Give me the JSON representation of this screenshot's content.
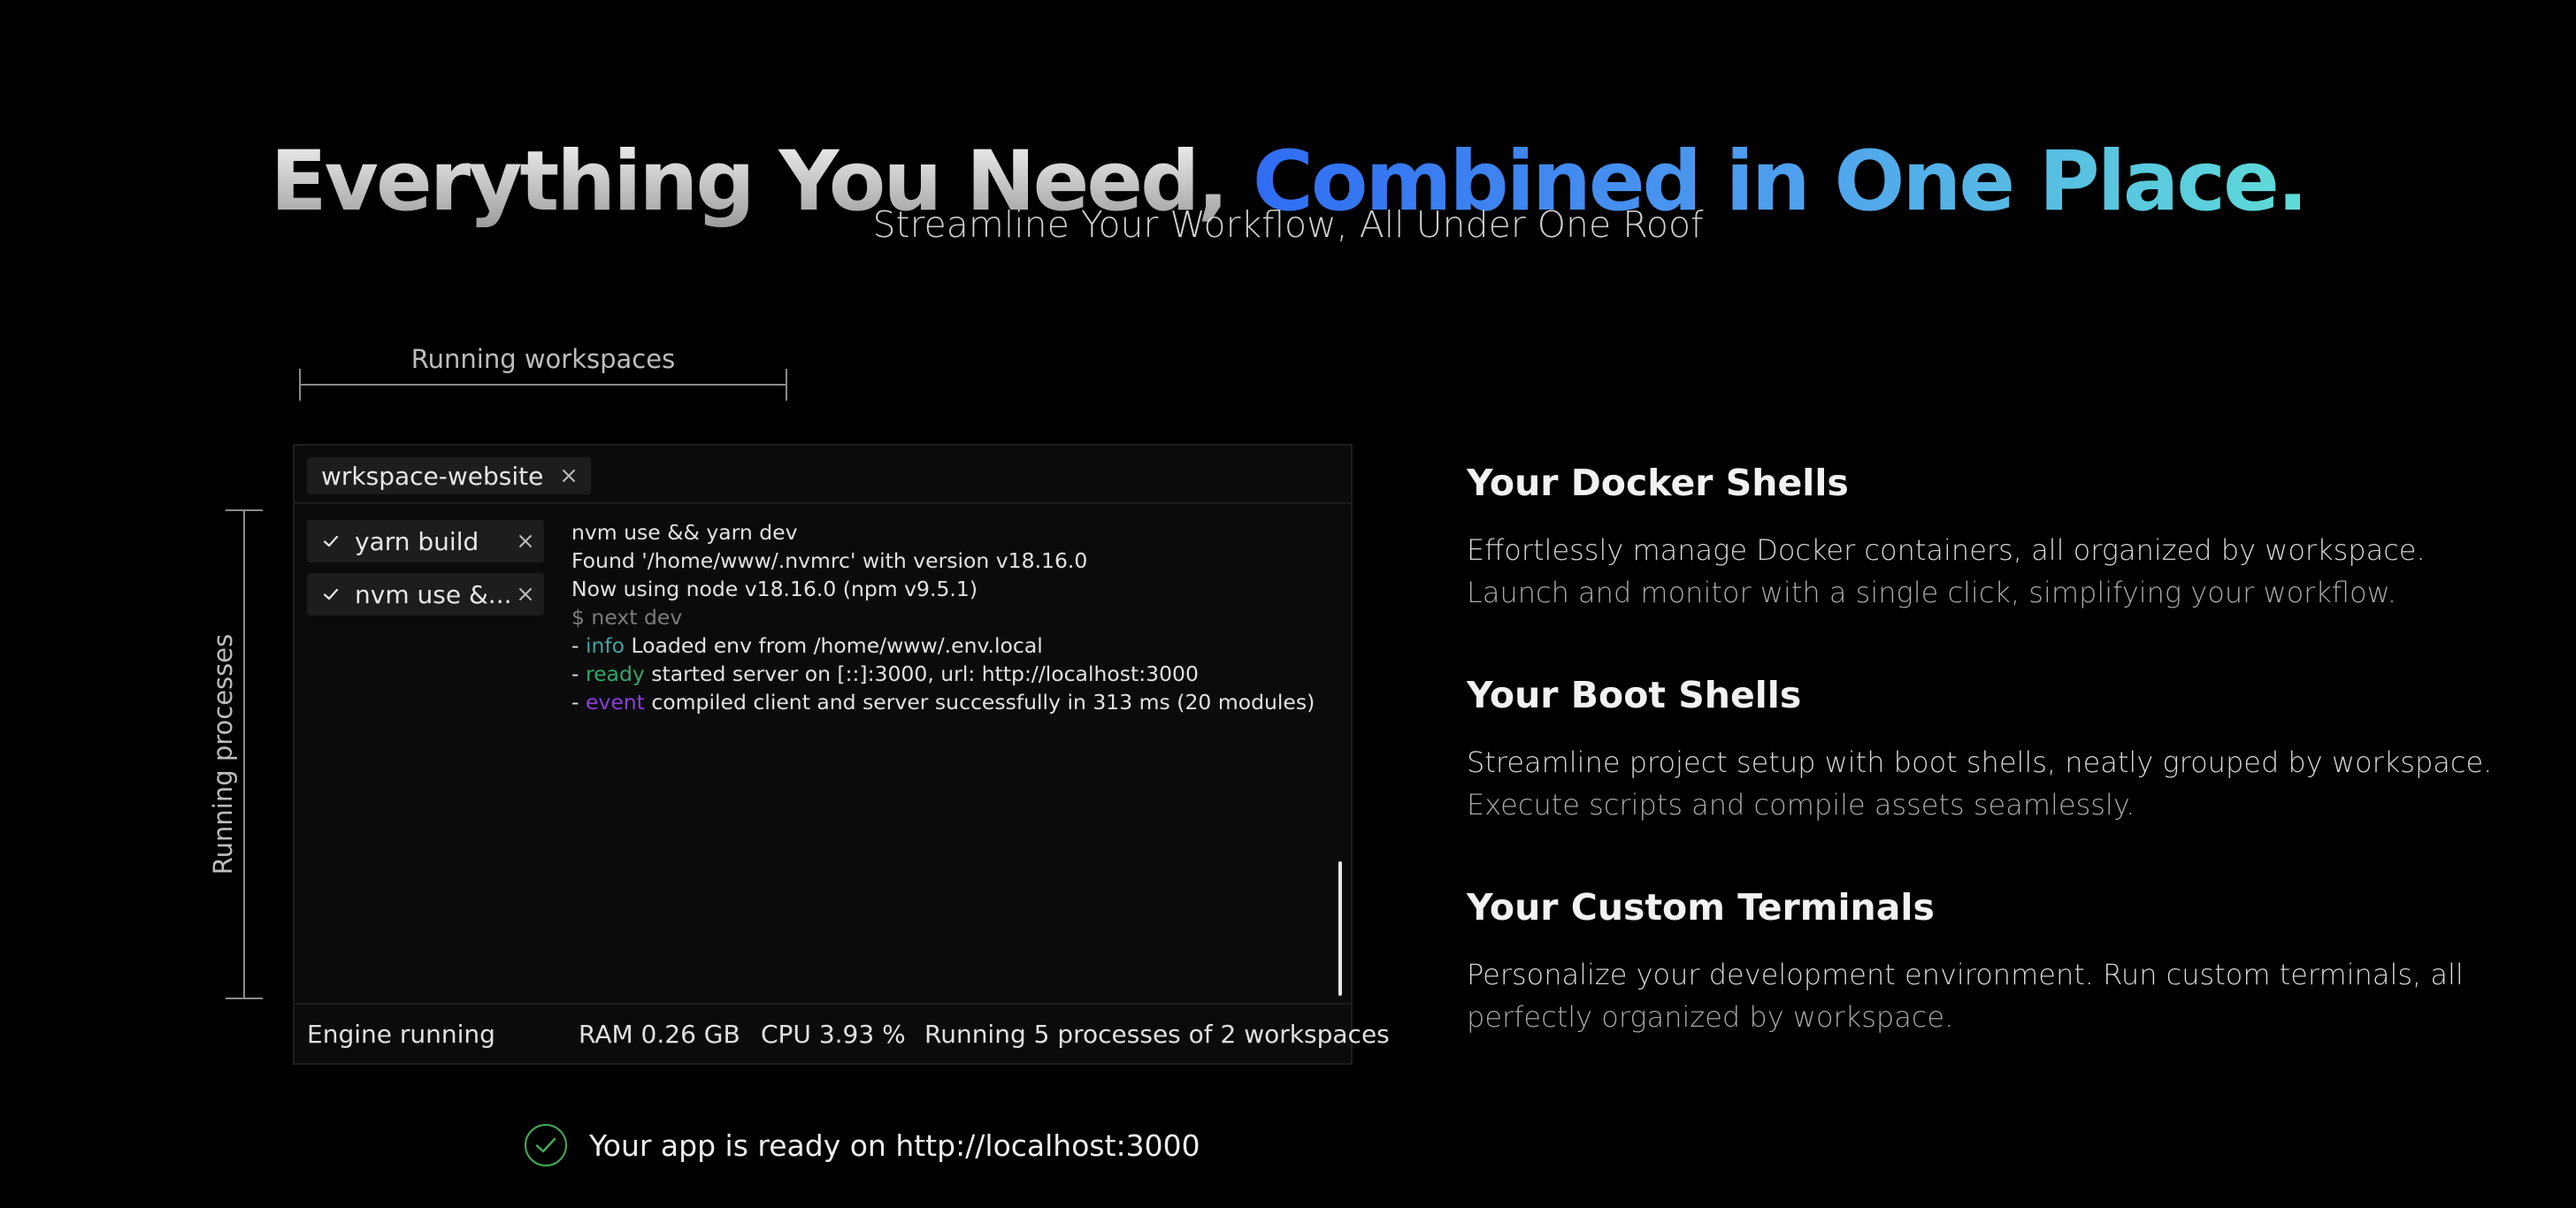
{
  "header": {
    "title_plain": "Everything You Need, ",
    "title_accent": "Combined in One Place.",
    "subtitle": "Streamline Your Workflow, All Under One Roof"
  },
  "annotations": {
    "workspaces_label": "Running workspaces",
    "processes_label": "Running processes"
  },
  "terminal": {
    "tab": {
      "label": "wrkspace-website"
    },
    "processes": [
      {
        "label": "yarn build"
      },
      {
        "label": "nvm use &..."
      }
    ],
    "log": [
      {
        "text": "nvm use && yarn dev"
      },
      {
        "text": "Found '/home/www/.nvmrc' with version v18.16.0"
      },
      {
        "text": "Now using node v18.16.0 (npm v9.5.1)"
      },
      {
        "text": "$ next dev"
      },
      {
        "prefix": "- ",
        "tag": "info",
        "rest": " Loaded env from /home/www/.env.local"
      },
      {
        "prefix": "- ",
        "tag": "ready",
        "rest": " started server on [::]:3000, url: http://localhost:3000"
      },
      {
        "prefix": "- ",
        "tag": "event",
        "rest": " compiled client and server successfully in 313 ms (20 modules)"
      }
    ],
    "status": {
      "engine": "Engine running",
      "ram": "RAM 0.26 GB",
      "cpu": "CPU 3.93 %",
      "summary": "Running 5 processes of 2 workspaces"
    }
  },
  "ready_message": "Your app is ready on http://localhost:3000",
  "features": [
    {
      "title": "Your Docker Shells",
      "line1": "Effortlessly manage Docker containers, all organized by workspace.",
      "line2": "Launch and monitor with a single click, simplifying your workflow."
    },
    {
      "title": "Your Boot Shells",
      "line1": "Streamline project setup with boot shells, neatly grouped by workspace.",
      "line2": "Execute scripts and compile assets seamlessly."
    },
    {
      "title": "Your Custom Terminals",
      "line1": "Personalize your development environment. Run custom terminals, all",
      "line2": "perfectly organized by workspace."
    }
  ],
  "colors": {
    "accent_start": "#2f6cf3",
    "accent_end": "#5fdcd7",
    "info": "#3fa3a3",
    "ready": "#34a66a",
    "event": "#8b3fd8",
    "success_icon": "#3fae58"
  }
}
